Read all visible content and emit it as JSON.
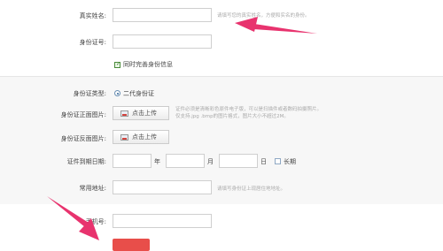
{
  "form": {
    "real_name": {
      "label": "真实姓名:",
      "hint": "请填写您的真实姓名，方便和实名的身份。"
    },
    "id_number": {
      "label": "身份证号:"
    },
    "sync_checkbox": {
      "label": "同时完善身份信息",
      "checked": true
    },
    "id_type": {
      "label": "身份证类型:",
      "value": "二代身份证"
    },
    "id_front": {
      "label": "身份证正面图片:",
      "button": "点击上传",
      "hint_line1": "证件必须是清晰彩色原件电子版，可以是扫描件或者数码拍摄照片。",
      "hint_line2": "仅支持.jpg .bmp的图片格式，图片大小不超过2M。"
    },
    "id_back": {
      "label": "身份证反面图片:",
      "button": "点击上传"
    },
    "expiry": {
      "label": "证件到期日期:",
      "year": "年",
      "month": "月",
      "day": "日",
      "long_term": "长期"
    },
    "address": {
      "label": "常用地址:",
      "hint": "请填写身份证上现居住地地址。"
    },
    "phone": {
      "label": "手机号:"
    }
  },
  "colors": {
    "arrow": "#e8336e",
    "submit": "#e84e4a"
  }
}
